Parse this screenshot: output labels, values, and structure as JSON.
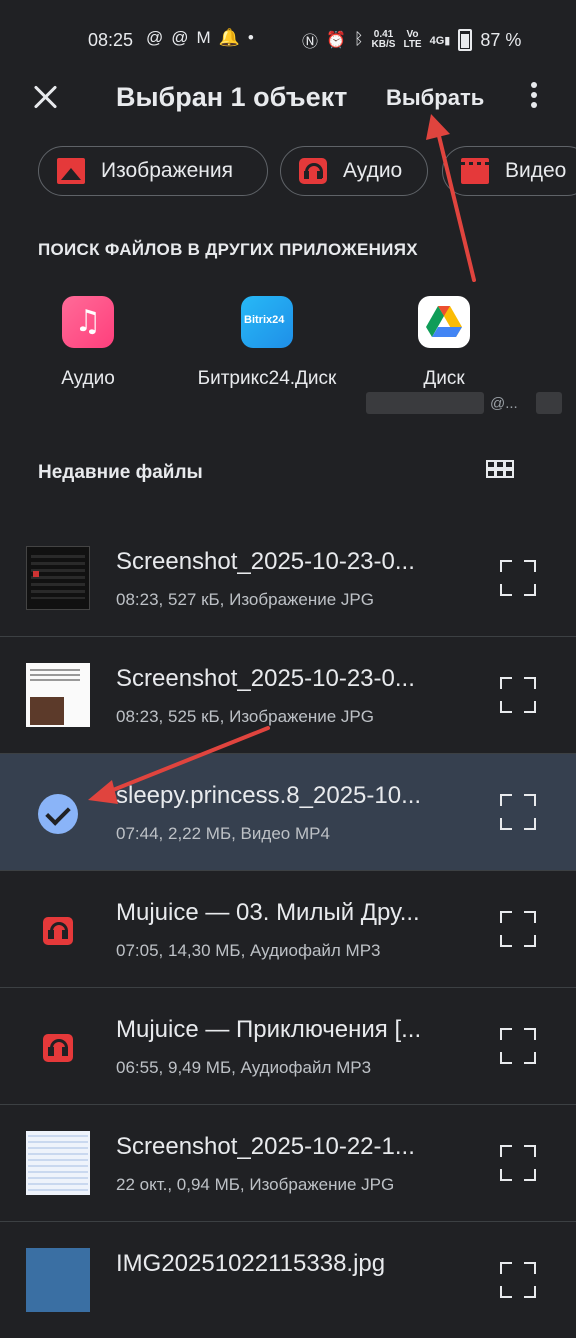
{
  "status_bar": {
    "time": "08:25",
    "left_icons": [
      "@",
      "@",
      "M",
      "🔔",
      "•"
    ],
    "net_speed_top": "0.41",
    "net_speed_bottom": "KB/S",
    "volte_top": "Vo",
    "volte_bottom": "LTE",
    "signal_label": "4G",
    "battery_percent": "87 %"
  },
  "toolbar": {
    "title": "Выбран 1 объект",
    "select_label": "Выбрать"
  },
  "chips": [
    {
      "label": "Изображения",
      "icon": "image-icon"
    },
    {
      "label": "Аудио",
      "icon": "headphones-icon"
    },
    {
      "label": "Видео",
      "icon": "video-icon"
    }
  ],
  "other_apps": {
    "title": "ПОИСК ФАЙЛОВ В ДРУГИХ ПРИЛОЖЕНИЯХ",
    "apps": [
      {
        "label": "Аудио",
        "icon": "music-note-icon"
      },
      {
        "label": "Битрикс24.Диск",
        "icon": "bitrix24-icon",
        "icon_text": "Bitrix24"
      },
      {
        "label": "Диск",
        "icon": "google-drive-icon"
      }
    ],
    "account_fragment": "@..."
  },
  "recent": {
    "title": "Недавние файлы",
    "files": [
      {
        "name": "Screenshot_2025-10-23-0...",
        "meta": "08:23, 527 кБ, Изображение JPG",
        "kind": "screenshot-dark",
        "selected": false
      },
      {
        "name": "Screenshot_2025-10-23-0...",
        "meta": "08:23, 525 кБ, Изображение JPG",
        "kind": "screenshot-light",
        "selected": false
      },
      {
        "name": "sleepy.princess.8_2025-10...",
        "meta": "07:44, 2,22 МБ, Видео MP4",
        "kind": "video",
        "selected": true
      },
      {
        "name": "Mujuice — 03. Милый Дру...",
        "meta": "07:05, 14,30 МБ, Аудиофайл MP3",
        "kind": "audio",
        "selected": false
      },
      {
        "name": "Mujuice — Приключения [...",
        "meta": "06:55, 9,49 МБ, Аудиофайл MP3",
        "kind": "audio",
        "selected": false
      },
      {
        "name": "Screenshot_2025-10-22-1...",
        "meta": "22 окт., 0,94 МБ, Изображение JPG",
        "kind": "screenshot-table",
        "selected": false
      },
      {
        "name": "IMG20251022115338.jpg",
        "meta": "",
        "kind": "photo",
        "selected": false
      }
    ]
  },
  "colors": {
    "background": "#202124",
    "selected_row": "#36404f",
    "accent_red": "#e5393a",
    "check_blue": "#8ab4f8",
    "annotation_arrow": "#e0443e"
  }
}
